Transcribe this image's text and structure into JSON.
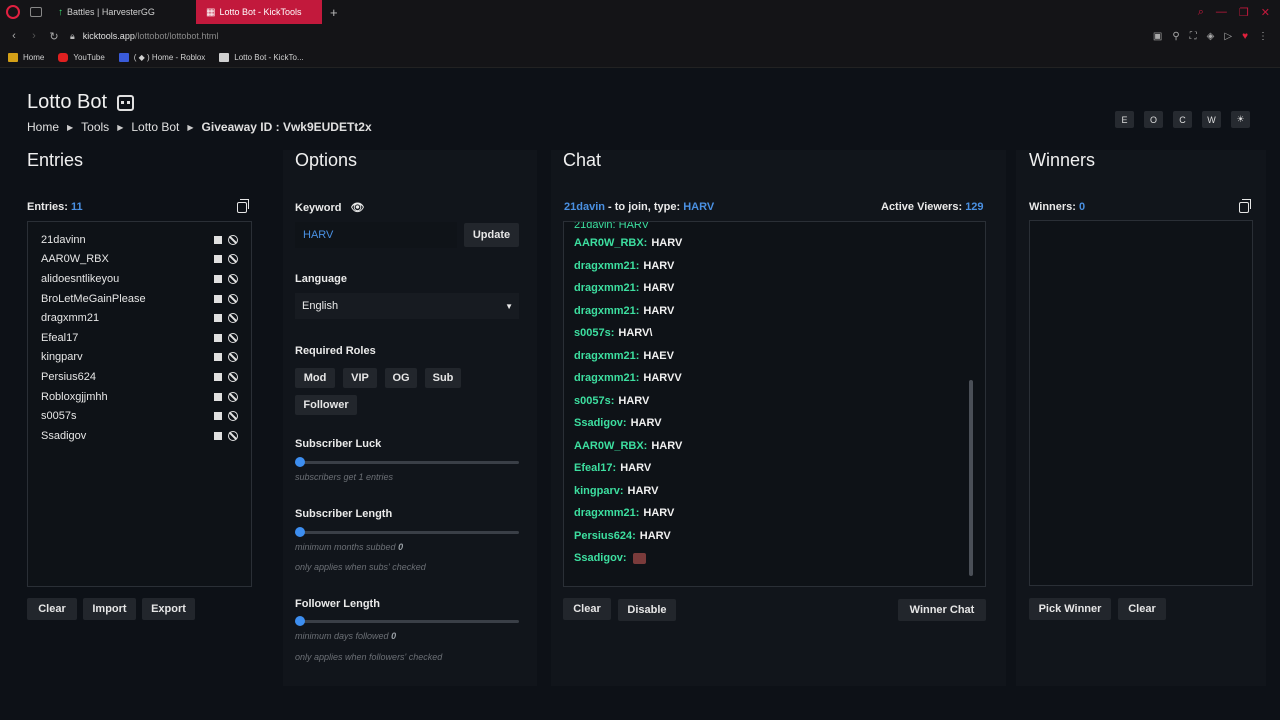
{
  "browser": {
    "tabs": [
      {
        "label": "Battles | HarvesterGG",
        "active": false
      },
      {
        "label": "Lotto Bot - KickTools",
        "active": true
      }
    ],
    "url_host": "kicktools.app",
    "url_path": "/lottobot/lottobot.html",
    "bookmarks": [
      {
        "label": "Home",
        "color": "#d4a017"
      },
      {
        "label": "YouTube",
        "color": "#e02020"
      },
      {
        "label": "( ◆ ) Home - Roblox",
        "color": "#3a5bd9"
      },
      {
        "label": "Lotto Bot - KickTo...",
        "color": "#d0d0d0"
      }
    ]
  },
  "header": {
    "title": "Lotto Bot",
    "breadcrumbs": [
      "Home",
      "Tools",
      "Lotto Bot"
    ],
    "giveaway_label": "Giveaway ID :",
    "giveaway_id": "Vwk9EUDETt2x",
    "buttons": [
      "E",
      "O",
      "C",
      "W",
      "☀"
    ]
  },
  "entries": {
    "title": "Entries",
    "count_label": "Entries:",
    "count": "11",
    "list": [
      "21davinn",
      "AAR0W_RBX",
      "alidoesntlikeyou",
      "BroLetMeGainPlease",
      "dragxmm21",
      "Efeal17",
      "kingparv",
      "Persius624",
      "Robloxgjjmhh",
      "s0057s",
      "Ssadigov"
    ],
    "buttons": [
      "Clear",
      "Import",
      "Export"
    ]
  },
  "options": {
    "title": "Options",
    "keyword_label": "Keyword",
    "keyword": "HARV",
    "update_label": "Update",
    "language_label": "Language",
    "language": "English",
    "roles_label": "Required Roles",
    "roles": [
      "Mod",
      "VIP",
      "OG",
      "Sub",
      "Follower"
    ],
    "sub_luck_label": "Subscriber Luck",
    "sub_luck_hint": "subscribers get 1 entries",
    "sub_length_label": "Subscriber Length",
    "sub_length_hint_prefix": "minimum months subbed",
    "sub_length_value": "0",
    "sub_length_note": "only applies when subs' checked",
    "follower_length_label": "Follower Length",
    "follower_length_hint_prefix": "minimum days followed",
    "follower_length_value": "0",
    "follower_length_note": "only applies when followers' checked"
  },
  "chat": {
    "title": "Chat",
    "join_user": "21davin",
    "join_text": "- to join, type:",
    "join_keyword": "HARV",
    "viewers_label": "Active Viewers:",
    "viewers": "129",
    "messages": [
      {
        "user": "AAR0W_RBX:",
        "msg": "HARV"
      },
      {
        "user": "dragxmm21:",
        "msg": "HARV"
      },
      {
        "user": "dragxmm21:",
        "msg": "HARV"
      },
      {
        "user": "dragxmm21:",
        "msg": "HARV"
      },
      {
        "user": "s0057s:",
        "msg": "HARV\\"
      },
      {
        "user": "dragxmm21:",
        "msg": "HAEV"
      },
      {
        "user": "dragxmm21:",
        "msg": "HARVV"
      },
      {
        "user": "s0057s:",
        "msg": "HARV"
      },
      {
        "user": "Ssadigov:",
        "msg": "HARV"
      },
      {
        "user": "AAR0W_RBX:",
        "msg": "HARV"
      },
      {
        "user": "Efeal17:",
        "msg": "HARV"
      },
      {
        "user": "kingparv:",
        "msg": "HARV"
      },
      {
        "user": "dragxmm21:",
        "msg": "HARV"
      },
      {
        "user": "Persius624:",
        "msg": "HARV"
      },
      {
        "user": "Ssadigov:",
        "msg": ""
      }
    ],
    "buttons": [
      "Clear",
      "Disable",
      "Winner Chat"
    ]
  },
  "winners": {
    "title": "Winners",
    "count_label": "Winners:",
    "count": "0",
    "buttons": [
      "Pick Winner",
      "Clear"
    ]
  }
}
